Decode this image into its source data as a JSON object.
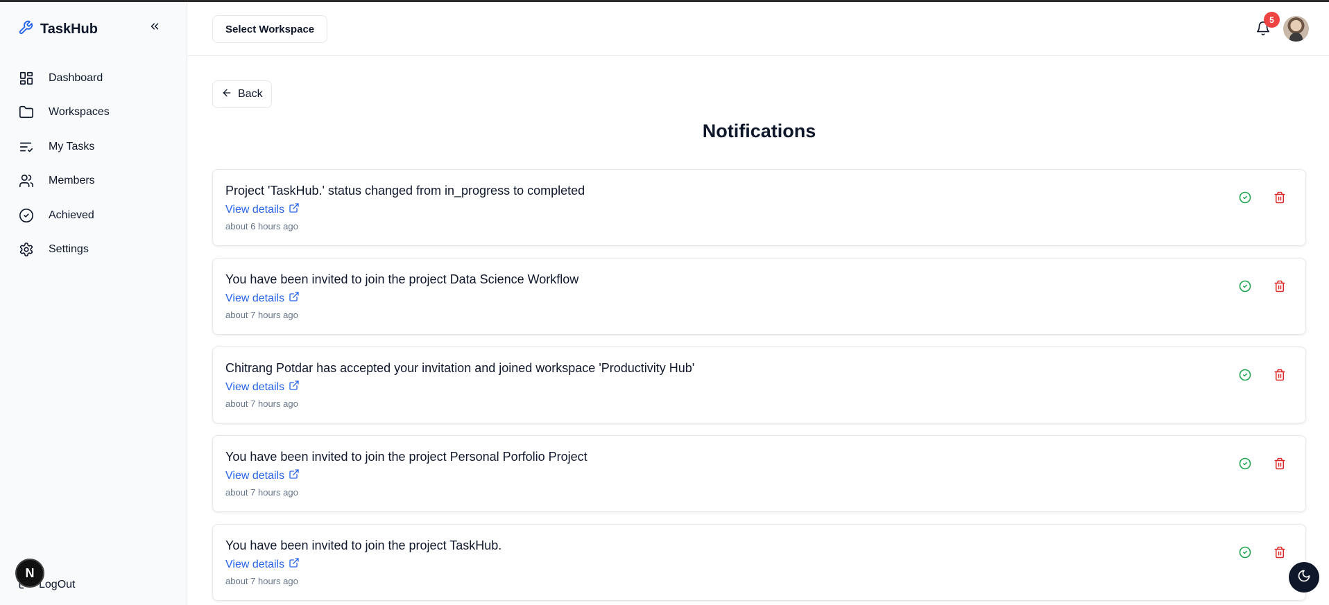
{
  "app": {
    "name": "TaskHub"
  },
  "sidebar": {
    "items": [
      {
        "label": "Dashboard",
        "icon": "dashboard-icon"
      },
      {
        "label": "Workspaces",
        "icon": "folder-icon"
      },
      {
        "label": "My Tasks",
        "icon": "list-check-icon"
      },
      {
        "label": "Members",
        "icon": "users-icon"
      },
      {
        "label": "Achieved",
        "icon": "check-circle-icon"
      },
      {
        "label": "Settings",
        "icon": "gear-icon"
      }
    ],
    "logout_label": "LogOut",
    "dev_badge": "N"
  },
  "header": {
    "workspace_button": "Select Workspace",
    "notification_count": "5"
  },
  "main": {
    "back_label": "Back",
    "title": "Notifications",
    "view_details_label": "View details",
    "notifications": [
      {
        "message": "Project 'TaskHub.' status changed from in_progress to completed",
        "time": "about 6 hours ago"
      },
      {
        "message": "You have been invited to join the project Data Science Workflow",
        "time": "about 7 hours ago"
      },
      {
        "message": "Chitrang Potdar has accepted your invitation and joined workspace 'Productivity Hub'",
        "time": "about 7 hours ago"
      },
      {
        "message": "You have been invited to join the project Personal Porfolio Project",
        "time": "about 7 hours ago"
      },
      {
        "message": "You have been invited to join the project TaskHub.",
        "time": "about 7 hours ago"
      }
    ]
  },
  "colors": {
    "accent": "#2563eb",
    "success": "#16a34a",
    "danger": "#dc2626",
    "badge": "#ef4444"
  }
}
